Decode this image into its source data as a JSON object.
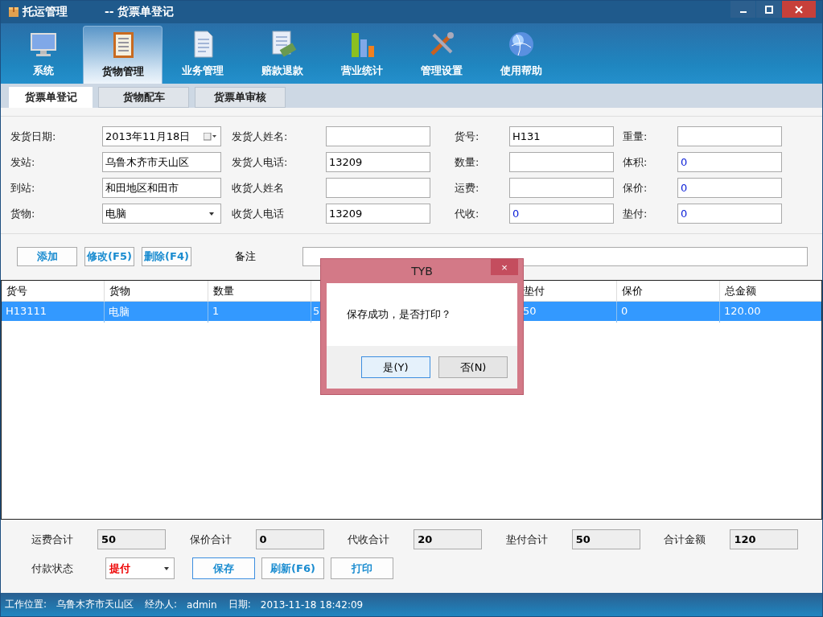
{
  "window": {
    "title": "托运管理",
    "subtitle": "--  货票单登记"
  },
  "toolbar": [
    {
      "label": "系统",
      "selected": false
    },
    {
      "label": "货物管理",
      "selected": true
    },
    {
      "label": "业务管理",
      "selected": false
    },
    {
      "label": "赔款退款",
      "selected": false
    },
    {
      "label": "营业统计",
      "selected": false
    },
    {
      "label": "管理设置",
      "selected": false
    },
    {
      "label": "使用帮助",
      "selected": false
    }
  ],
  "tabs": [
    {
      "label": "货票单登记",
      "selected": true
    },
    {
      "label": "货物配车",
      "selected": false
    },
    {
      "label": "货票单审核",
      "selected": false
    }
  ],
  "form": [
    [
      {
        "label": "发货日期:",
        "kind": "date",
        "value": "2013年11月18日"
      },
      {
        "label": "发站:",
        "kind": "text",
        "value": "乌鲁木齐市天山区"
      },
      {
        "label": "到站:",
        "kind": "text",
        "value": "和田地区和田市"
      },
      {
        "label": "货物:",
        "kind": "select",
        "value": "电脑"
      }
    ],
    [
      {
        "label": "发货人姓名:",
        "kind": "text"
      },
      {
        "label": "发货人电话:",
        "kind": "text",
        "value": "13209"
      },
      {
        "label": "收货人姓名",
        "kind": "text"
      },
      {
        "label": "收货人电话",
        "kind": "text",
        "value": "13209"
      }
    ],
    [
      {
        "label": "货号:",
        "kind": "text",
        "value": "H131"
      },
      {
        "label": "数量:",
        "kind": "number"
      },
      {
        "label": "运费:",
        "kind": "number"
      },
      {
        "label": "代收:",
        "kind": "number",
        "value": "0"
      }
    ],
    [
      {
        "label": "重量:",
        "kind": "number"
      },
      {
        "label": "体积:",
        "kind": "number",
        "value": "0"
      },
      {
        "label": "保价:",
        "kind": "number",
        "value": "0"
      },
      {
        "label": "垫付:",
        "kind": "number",
        "value": "0"
      }
    ]
  ],
  "actions": [
    "添加",
    "修改(F5)",
    "删除(F4)"
  ],
  "remark": {
    "label": "备注"
  },
  "table": {
    "columns": [
      "货号",
      "货物",
      "数量",
      null,
      null,
      "垫付",
      "保价",
      "总金额"
    ],
    "rows": [
      {
        "selected": true,
        "cells": [
          "H13111",
          "电脑",
          "1",
          "5",
          null,
          "50",
          "0",
          "120.00"
        ]
      }
    ]
  },
  "totals": [
    {
      "label": "运费合计",
      "value": "50"
    },
    {
      "label": "保价合计",
      "value": "0"
    },
    {
      "label": "代收合计",
      "value": "20"
    },
    {
      "label": "垫付合计",
      "value": "50"
    },
    {
      "label": "合计金额",
      "value": "120"
    }
  ],
  "payment": {
    "label": "付款状态",
    "value": "提付"
  },
  "buttons": [
    "保存",
    "刷新(F6)",
    "打印"
  ],
  "status_bar": [
    "工作位置:",
    "乌鲁木齐市天山区",
    "经办人:",
    "admin",
    "日期:",
    "2013-11-18 18:42:09"
  ],
  "dialog": {
    "title": "TYB",
    "close": "×",
    "message": "保存成功，是否打印？",
    "buttons": [
      "是(Y)",
      "否(N)"
    ]
  }
}
